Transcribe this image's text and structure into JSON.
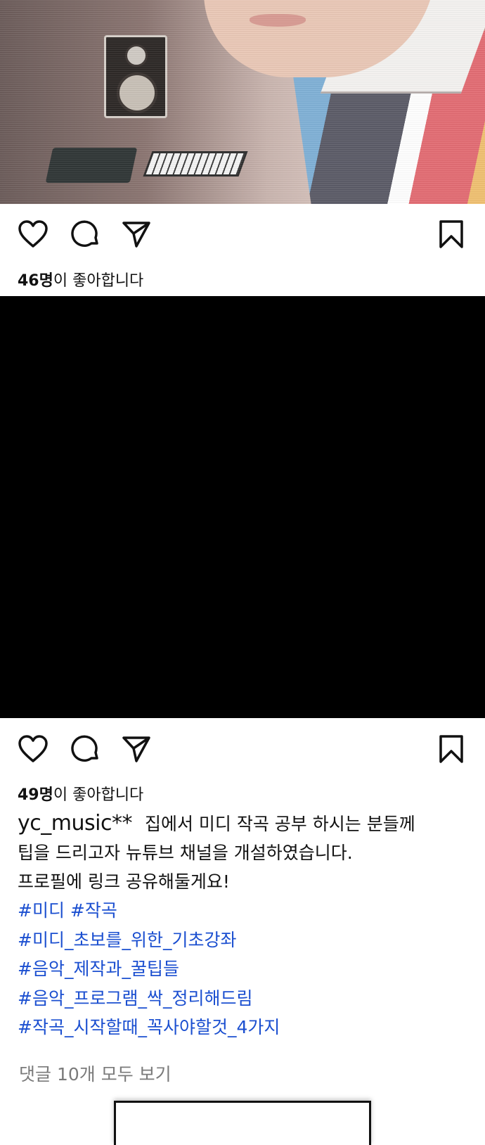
{
  "post1": {
    "likes_count": "46명",
    "likes_suffix": "이 좋아합니다"
  },
  "post2": {
    "likes_count": "49명",
    "likes_suffix": "이 좋아합니다",
    "username": "yc_music**",
    "caption_lines": [
      "집에서 미디 작곡 공부 하시는 분들께",
      "팁을 드리고자 뉴튜브 채널을 개설하였습니다.",
      "프로필에 링크 공유해둘게요!"
    ],
    "hashtags": [
      "#미디 #작곡",
      "#미디_초보를_위한_기초강좌",
      "#음악_제작과_꿀팁들",
      "#음악_프로그램_싹_정리해드림",
      "#작곡_시작할때_꼭사야할것_4가지"
    ],
    "comments_link": "댓글 10개 모두 보기"
  },
  "icons": [
    "heart-icon",
    "comment-icon",
    "share-icon",
    "bookmark-icon"
  ],
  "colors": {
    "hashtag": "#1b4fd0",
    "comments_link": "#7a7a7a",
    "black_panel": "#000000"
  }
}
